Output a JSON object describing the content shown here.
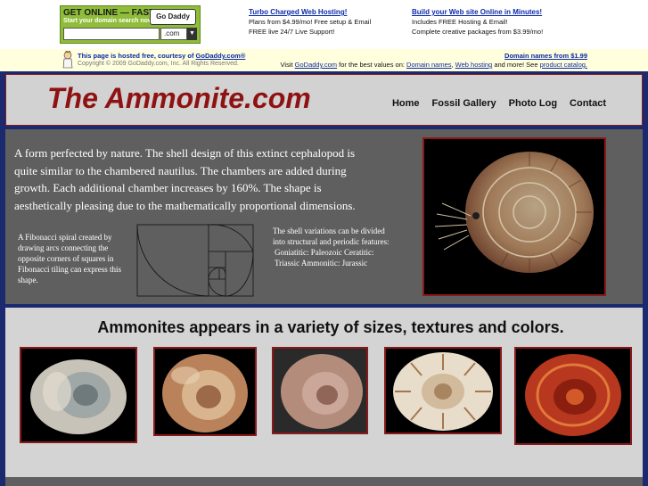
{
  "ad": {
    "headline": "GET ONLINE — FAST!",
    "subline": "Start your domain search now",
    "logo": "Go Daddy",
    "tld": ".com",
    "promos": [
      {
        "title": "Turbo Charged Web Hosting!",
        "lines": [
          "Plans from $4.99/mo! Free setup & Email",
          "FREE live 24/7 Live Support!"
        ]
      },
      {
        "title": "Build your Web site Online in Minutes!",
        "lines": [
          "Includes FREE Hosting & Email!",
          "Complete creative packages from $3.99/mo!"
        ]
      }
    ]
  },
  "hosted": {
    "prefix": "This page is hosted free, courtesy of",
    "link": "GoDaddy.com®",
    "copyright": "Copyright © 2009 GoDaddy.com, Inc. All Rights Reserved.",
    "domain_price": "Domain names from $1.99",
    "visit_prefix": "Visit",
    "visit_link": "GoDaddy.com",
    "visit_middle": "for the best values on:",
    "links": [
      "Domain names",
      "Web hosting"
    ],
    "visit_suffix": "and more! See",
    "catalog": "product catalog."
  },
  "site": {
    "title": "The Ammonite.com",
    "nav": [
      "Home",
      "Fossil Gallery",
      "Photo Log",
      "Contact"
    ]
  },
  "intro": {
    "text": "A form perfected by nature. The shell design of this extinct cephalopod is quite similar to the chambered nautilus. The chambers are added during growth. Each additional chamber increases by 160%. The shape is aesthetically pleasing due to the mathematically proportional dimensions.",
    "fib_caption": "A Fibonacci spiral created by drawing arcs connecting the opposite corners of squares in Fibonacci tiling can express this shape.",
    "variations_text": "The shell variations can be divided into structural and periodic features:",
    "variations_types": [
      "Goniatitic: Paleozoic Ceratitic:",
      "Triassic Ammonitic: Jurassic"
    ],
    "hero_image": "ammonite-illustration"
  },
  "gallery": {
    "heading": "Ammonites appears in a variety of sizes, textures and colors.",
    "images": [
      "iridescent-ammonite",
      "opal-ammonite",
      "pink-ammonite",
      "ribbed-ammonite",
      "red-cut-ammonite"
    ]
  },
  "colors": {
    "accent": "#8e1212",
    "header_bg": "#d2d2d2",
    "intro_bg": "#5f5f5f",
    "page_border": "#1b2a6e",
    "link": "#0b2aa8"
  }
}
